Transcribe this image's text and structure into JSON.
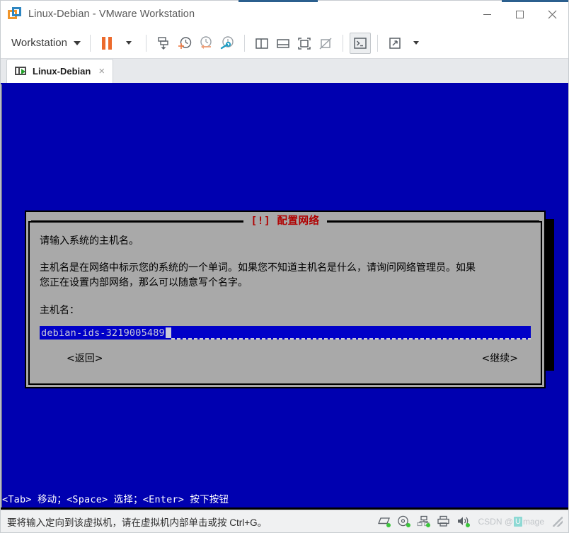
{
  "window": {
    "title": "Linux-Debian - VMware Workstation",
    "app_icon": "vmware-logo-icon",
    "minimize_label": "Minimize",
    "maximize_label": "Maximize",
    "close_label": "Close"
  },
  "toolbar": {
    "workstation_menu": "Workstation",
    "items": [
      {
        "name": "pause-vm-button",
        "icon": "pause-icon"
      },
      {
        "name": "pause-dropdown-button",
        "icon": "chevron-down-icon"
      },
      {
        "name": "send-ctrl-alt-del-button",
        "icon": "snapshot-save-icon"
      },
      {
        "name": "take-snapshot-button",
        "icon": "clock-plus-icon"
      },
      {
        "name": "revert-snapshot-button",
        "icon": "clock-back-icon"
      },
      {
        "name": "manage-snapshots-button",
        "icon": "clock-wrench-icon"
      },
      {
        "name": "show-library-button",
        "icon": "panel-left-icon"
      },
      {
        "name": "show-thumbnail-bar-button",
        "icon": "panel-bottom-icon"
      },
      {
        "name": "show-console-view-button",
        "icon": "fullscreen-box-icon"
      },
      {
        "name": "hide-console-view-button",
        "icon": "box-crossed-icon"
      },
      {
        "name": "unity-mode-button",
        "icon": "terminal-icon"
      },
      {
        "name": "full-screen-button",
        "icon": "expand-arrows-icon"
      },
      {
        "name": "full-screen-dropdown-button",
        "icon": "chevron-down-icon"
      }
    ]
  },
  "tabs": [
    {
      "label": "Linux-Debian",
      "icon": "vm-screen-play-icon",
      "close": "×",
      "active": true
    }
  ],
  "vm": {
    "background_color": "#0000b0",
    "dialog": {
      "title": "[!] 配置网络",
      "title_color": "#b00000",
      "background_color": "#a9a9a9",
      "paragraphs": [
        "请输入系统的主机名。",
        "主机名是在网络中标示您的系统的一个单词。如果您不知道主机名是什么，请询问网络管理员。如果",
        "您正在设置内部网络，那么可以随意写个名字。"
      ],
      "field_label": "主机名：",
      "field_value": "debian-ids-3219005489",
      "field_bg_color": "#0000c8",
      "back_button": "<返回>",
      "continue_button": "<继续>"
    },
    "help_line": "<Tab> 移动；<Space> 选择；<Enter> 按下按钮"
  },
  "statusbar": {
    "message": "要将输入定向到该虚拟机，请在虚拟机内部单击或按 Ctrl+G。",
    "icons": [
      {
        "name": "hard-disk-icon"
      },
      {
        "name": "cd-dvd-icon"
      },
      {
        "name": "network-adapter-icon"
      },
      {
        "name": "printer-icon"
      },
      {
        "name": "sound-card-icon"
      },
      {
        "name": "usb-device-icon"
      }
    ],
    "watermark_prefix": "CSDN @",
    "watermark_badge": "U",
    "watermark_suffix": "mage"
  }
}
